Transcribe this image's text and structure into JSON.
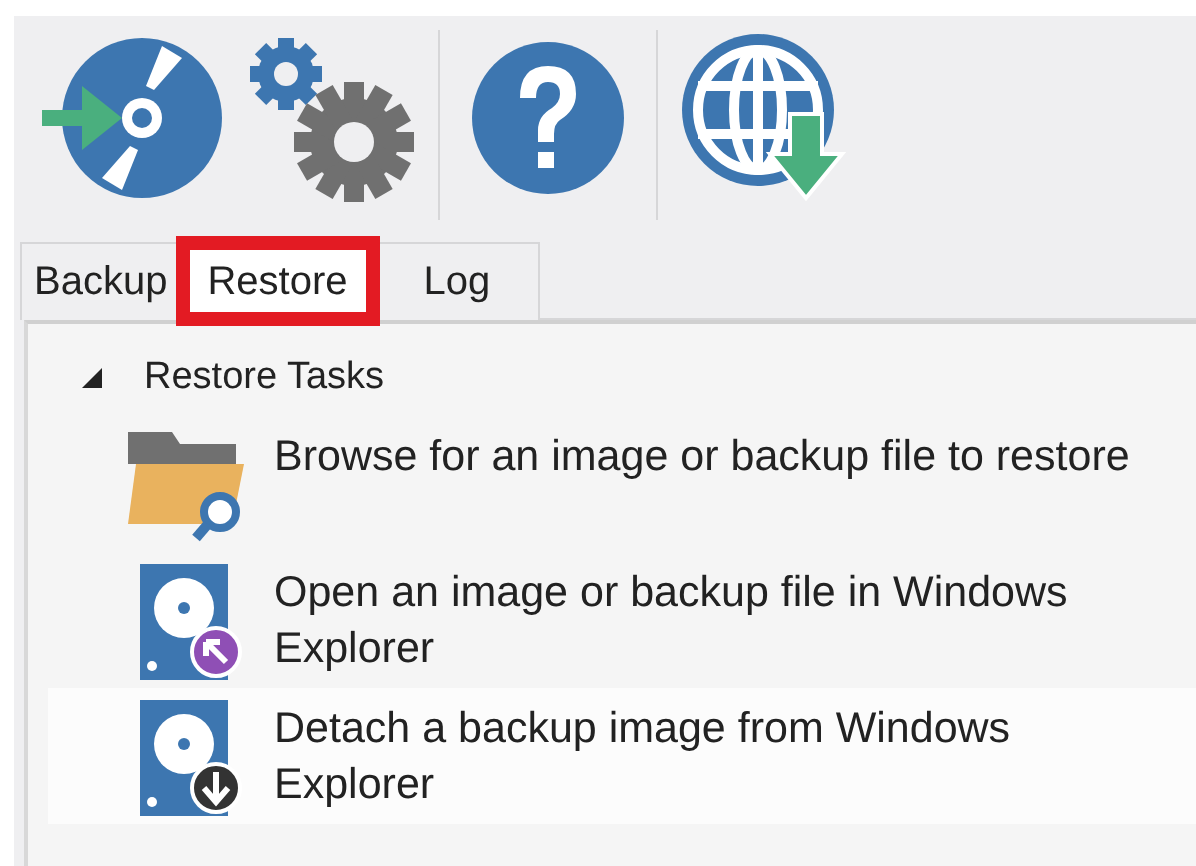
{
  "toolbar": {
    "buttons": [
      {
        "kind": "disc",
        "separator_after": false
      },
      {
        "kind": "gears",
        "separator_after": true
      },
      {
        "kind": "help",
        "separator_after": true
      },
      {
        "kind": "globe",
        "separator_after": false
      }
    ]
  },
  "tabs": [
    {
      "label": "Backup",
      "selected": false,
      "highlighted": false
    },
    {
      "label": "Restore",
      "selected": true,
      "highlighted": true
    },
    {
      "label": "Log",
      "selected": false,
      "highlighted": false
    }
  ],
  "task_group": {
    "title": "Restore Tasks",
    "expanded": true,
    "items": [
      {
        "kind": "folder-search",
        "label": "Browse for an image or backup file to restore",
        "selected": false
      },
      {
        "kind": "disk-open",
        "label": "Open an image or backup file in Windows Explorer",
        "selected": false
      },
      {
        "kind": "disk-detach",
        "label": "Detach a backup image from Windows Explorer",
        "selected": true
      }
    ]
  }
}
